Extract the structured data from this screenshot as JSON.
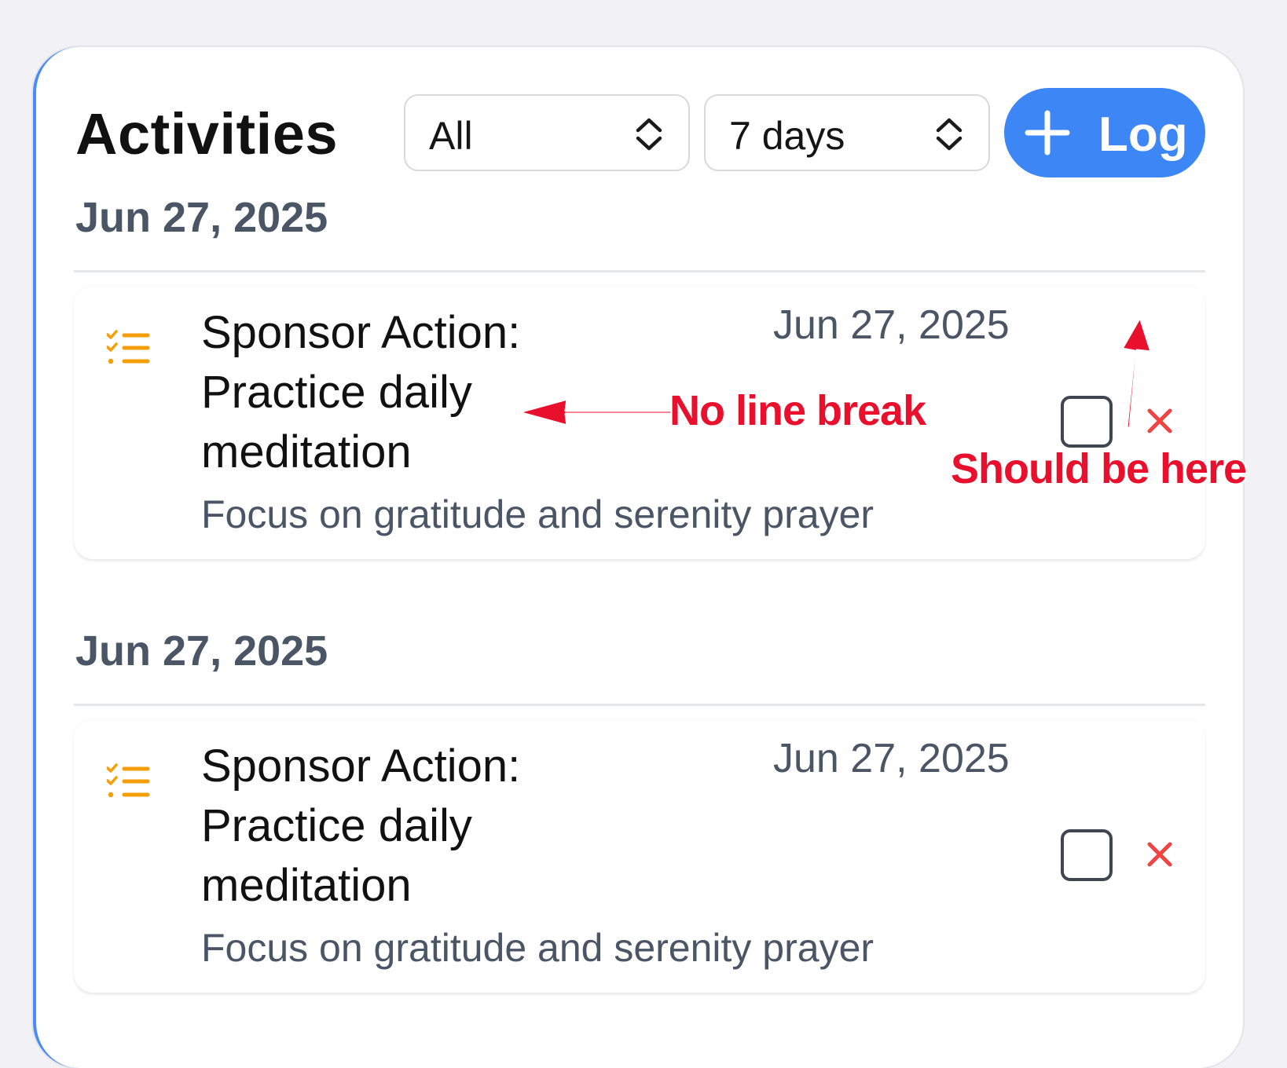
{
  "header": {
    "title": "Activities",
    "type_filter": {
      "selected": "All"
    },
    "range_filter": {
      "selected": "7 days"
    },
    "log_button_label": "Log"
  },
  "groups": [
    {
      "date": "Jun 27, 2025",
      "items": [
        {
          "icon": "checklist-icon",
          "title": "Sponsor Action: Practice daily meditation",
          "date": "Jun 27, 2025",
          "note": "Focus on gratitude and serenity prayer",
          "completed": false
        }
      ]
    },
    {
      "date": "Jun 27, 2025",
      "items": [
        {
          "icon": "checklist-icon",
          "title": "Sponsor Action: Practice daily meditation",
          "date": "Jun 27, 2025",
          "note": "Focus on gratitude and serenity prayer",
          "completed": false
        }
      ]
    }
  ],
  "annotations": {
    "no_line_break": "No line break",
    "should_be_here": "Should be here"
  },
  "colors": {
    "accent": "#3d86f5",
    "icon_orange": "#f59e0b",
    "delete_red": "#ef4444",
    "annotation_red": "#e8102c",
    "muted_text": "#4a5565"
  }
}
